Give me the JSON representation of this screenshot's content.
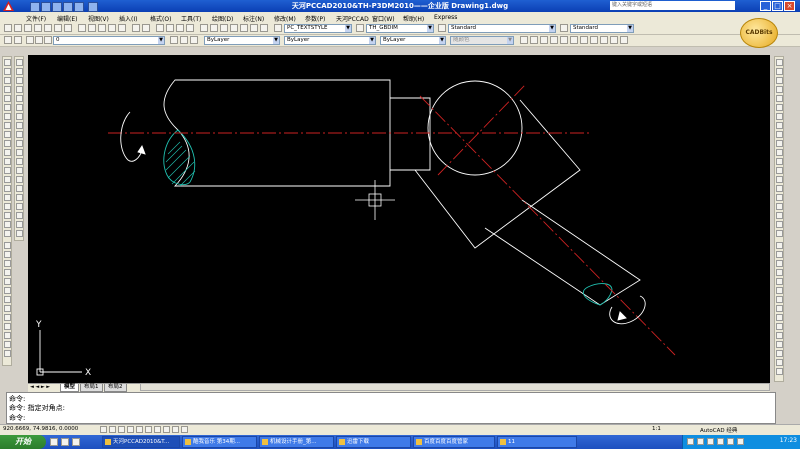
{
  "window": {
    "title": "天河PCCAD2010&TH-P3DM2010——企业版   Drawing1.dwg",
    "search_placeholder": "键入关键字或短语"
  },
  "menu": [
    "文件(F)",
    "编辑(E)",
    "视图(V)",
    "插入(I)",
    "格式(O)",
    "工具(T)",
    "绘图(D)",
    "标注(N)",
    "修改(M)",
    "参数(P)",
    "天河PCCAD",
    "窗口(W)",
    "帮助(H)",
    "Express"
  ],
  "toolbar": {
    "text_style": "PC_TEXTSTYLE",
    "dim_style": "TH_GBDIM",
    "table_style": "Standard",
    "multileader_style": "Standard",
    "layer": "0",
    "color": "ByLayer",
    "linetype": "ByLayer",
    "lineweight": "ByLayer",
    "plot_style": "随颜色"
  },
  "logo": {
    "text": "CADBits"
  },
  "canvas": {
    "background": "#000000",
    "line_color": "#ffffff",
    "centerline_color": "#cc2222",
    "hatch_color": "#20c0b0",
    "ucs_x": "X",
    "ucs_y": "Y"
  },
  "tabs": [
    "模型",
    "布局1",
    "布局2"
  ],
  "command": {
    "lines": [
      "命令:",
      "命令: 指定对角点:",
      "命令:"
    ]
  },
  "status": {
    "coords": "920.6669, 74.9816, 0.0000",
    "workspace": "AutoCAD 经典",
    "scale": "1:1"
  },
  "taskbar": {
    "start": "开始",
    "tasks": [
      "天河PCCAD2010&T...",
      "酷我音乐 第34期...",
      "机械设计手册_第...",
      "迅雷下载",
      "百度百度百度管家",
      "11"
    ],
    "clock": "17:23"
  }
}
